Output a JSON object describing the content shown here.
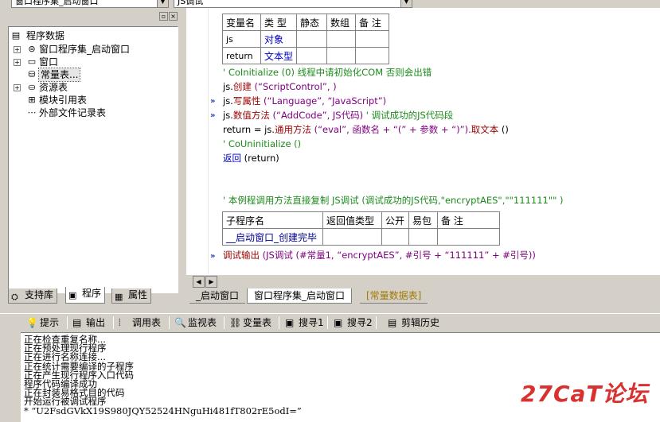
{
  "top": {
    "left_combo": "窗口程序集_启动窗口",
    "right_combo": "JS调试"
  },
  "tree": {
    "root": "程序数据",
    "items": [
      {
        "label": "窗口程序集_启动窗口",
        "icon": "module-icon"
      },
      {
        "label": "窗口",
        "icon": "window-icon"
      },
      {
        "label": "常量表...",
        "icon": "constant-icon"
      },
      {
        "label": "资源表",
        "icon": "resource-icon"
      },
      {
        "label": "模块引用表",
        "icon": "module-ref-icon"
      },
      {
        "label": "外部文件记录表",
        "icon": "file-record-icon"
      }
    ]
  },
  "left_tabs": [
    "支持库",
    "程序",
    "属性"
  ],
  "var_table": {
    "headers": [
      "变量名",
      "类 型",
      "静态",
      "数组",
      "备 注"
    ],
    "rows": [
      [
        "js",
        "对象",
        "",
        "",
        ""
      ],
      [
        "return",
        "文本型",
        "",
        "",
        ""
      ]
    ]
  },
  "code": {
    "l1": "' CoInitialize (0) 线程中请初始化COM  否则会出错",
    "l2a": "js.",
    "l2b": "创建",
    "l2c": " (“ScriptControl”, )",
    "l3a": "js.",
    "l3b": "写属性",
    "l3c": " (“Language”, “JavaScript”)",
    "l4a": "js.",
    "l4b": "数值方法",
    "l4c": " (“AddCode”, JS代码)  ",
    "l4d": "' 调试成功的JS代码段",
    "l5a": "return = js.",
    "l5b": "通用方法",
    "l5c": " (“eval”, 函数名 + “(” + 参数 + “)”).",
    "l5d": "取文本",
    "l5e": " ()",
    "l6": "' CoUninitialize ()",
    "l7a": "返回",
    "l7b": " (return)",
    "l8": "' 本例程调用方法直接复制    JS调试 (调试成功的JS代码,\"encryptAES\",\"\"111111\"\" )",
    "l9a": "调试输出",
    "l9b": " (JS调试 (#常量1, “encryptAES”, #引号 + “111111” + #引号))"
  },
  "sub_table": {
    "headers": [
      "子程序名",
      "返回值类型",
      "公开",
      "易包",
      "备 注"
    ],
    "row": [
      "__启动窗口_创建完毕",
      "",
      "",
      "",
      ""
    ]
  },
  "editor_tabs": [
    "_启动窗口",
    "窗口程序集_启动窗口",
    "[常量数据表]"
  ],
  "bottom_tabs": [
    {
      "label": "提示",
      "icon": "hint-icon"
    },
    {
      "label": "输出",
      "icon": "output-icon"
    },
    {
      "label": "调用表",
      "icon": "call-table-icon"
    },
    {
      "label": "监视表",
      "icon": "watch-icon"
    },
    {
      "label": "变量表",
      "icon": "variable-icon"
    },
    {
      "label": "搜寻1",
      "icon": "search1-icon"
    },
    {
      "label": "搜寻2",
      "icon": "search2-icon"
    },
    {
      "label": "剪辑历史",
      "icon": "clip-history-icon"
    }
  ],
  "output_lines": [
    "正在检查重复名称...",
    "正在预处理现行程序",
    "正在进行名称连接...",
    "正在统计需要编译的子程序",
    "正在产生现行程序入口代码",
    "程序代码编译成功",
    "正在封装易格式目的代码",
    "开始运行被调试程序",
    "* “U2FsdGVkX19S980JQY52524HNguHi481fT802rE5odI=”"
  ],
  "watermark": "27CaT论坛"
}
